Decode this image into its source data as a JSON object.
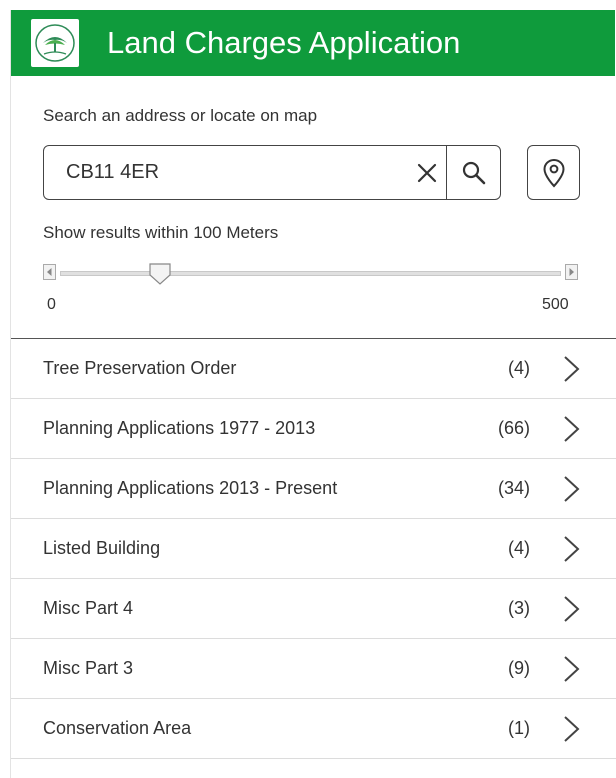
{
  "header": {
    "title": "Land Charges Application",
    "brand_color": "#0f9b3c"
  },
  "search": {
    "label": "Search an address or locate on map",
    "value": "CB11 4ER",
    "placeholder": "",
    "clear_icon": "close-icon",
    "search_icon": "search-icon",
    "locate_icon": "location-pin-icon"
  },
  "radius": {
    "label": "Show results within 100 Meters",
    "value": 100,
    "min": "0",
    "max": "500",
    "min_value": 0,
    "max_value": 500
  },
  "layers": [
    {
      "label": "Tree Preservation Order",
      "count": "(4)"
    },
    {
      "label": "Planning Applications 1977 - 2013",
      "count": "(66)"
    },
    {
      "label": "Planning Applications 2013 - Present",
      "count": "(34)"
    },
    {
      "label": "Listed Building",
      "count": "(4)"
    },
    {
      "label": "Misc Part 4",
      "count": "(3)"
    },
    {
      "label": "Misc Part 3",
      "count": "(9)"
    },
    {
      "label": "Conservation Area",
      "count": "(1)"
    }
  ]
}
